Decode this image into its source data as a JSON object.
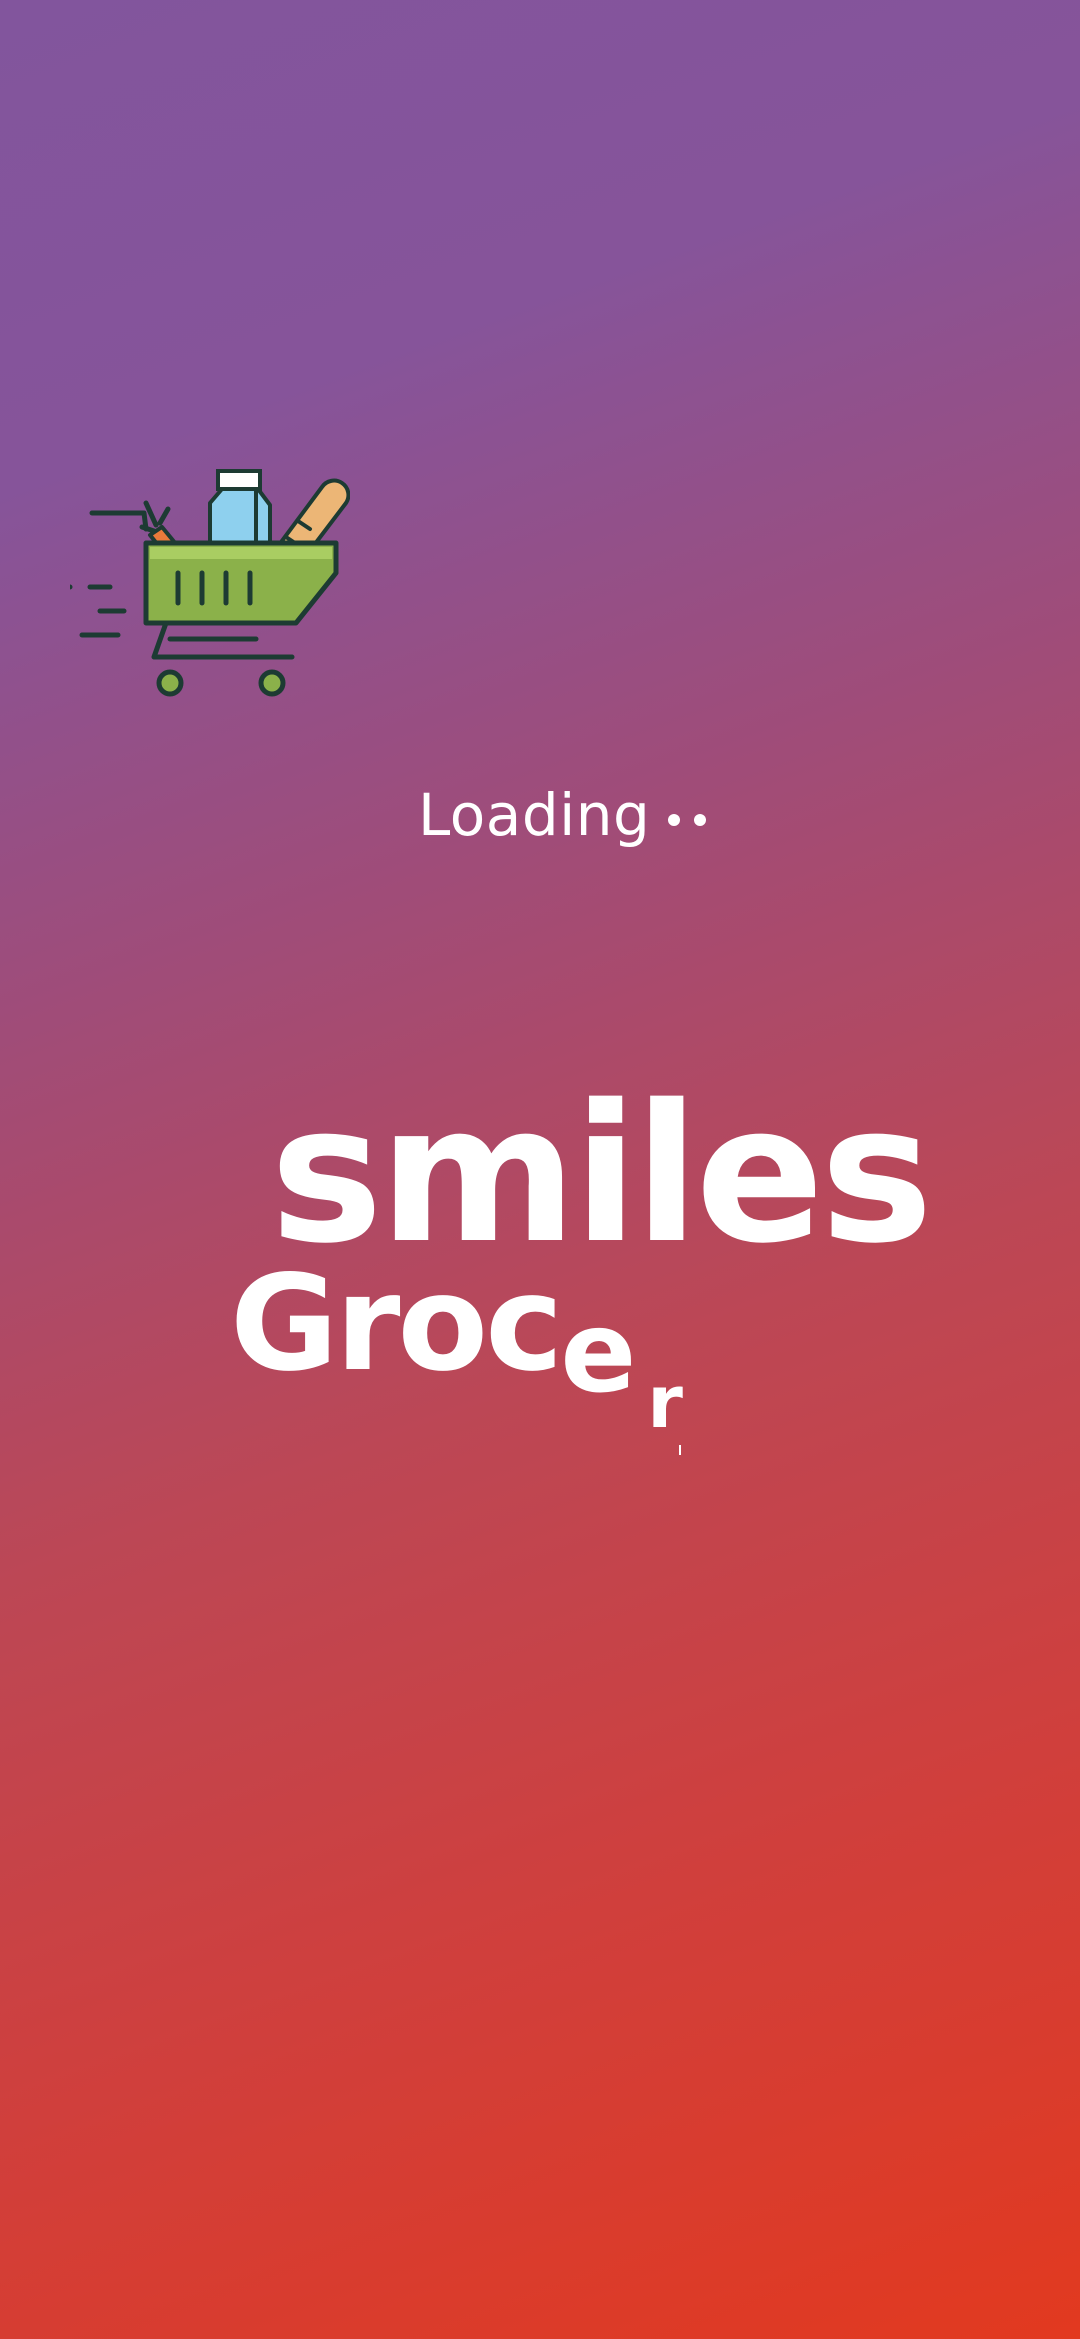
{
  "splash": {
    "loading_text": "Loading",
    "loading_dots": 2,
    "cart_icon": "grocery-cart-icon",
    "logo": {
      "line1": "smiles",
      "line2_part1": "Groc",
      "line2_part2": "e",
      "line2_part3": "r"
    }
  },
  "colors": {
    "gradient_start": "#82559d",
    "gradient_end": "#e2391f",
    "text": "#ffffff",
    "cart_green": "#8bb14a",
    "cart_outline": "#1d3b33"
  }
}
